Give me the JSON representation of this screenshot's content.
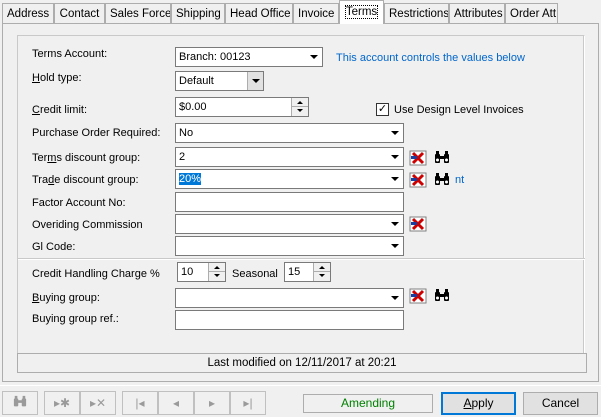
{
  "tabs": [
    "Address",
    "Contact",
    "Sales Force",
    "Shipping",
    "Head Office",
    "Invoice",
    "Terms",
    "Restrictions",
    "Attributes",
    "Order Att"
  ],
  "active_tab": "Terms",
  "form": {
    "terms_account": {
      "label": "Terms Account:",
      "value": "Branch: 00123"
    },
    "terms_account_note": "This account controls the values below",
    "hold_type": {
      "label_pre": "",
      "label_u": "H",
      "label_post": "old type:",
      "value": "Default"
    },
    "credit_limit": {
      "label_u": "C",
      "label_post": "redit limit:",
      "value": "$0.00"
    },
    "use_design_level_invoices": {
      "label": "Use Design Level Invoices",
      "checked_mark": "✓"
    },
    "purchase_order_required": {
      "label": "Purchase Order Required:",
      "value": "No"
    },
    "terms_discount_group": {
      "label_pre": "Ter",
      "label_u": "m",
      "label_post": "s discount group:",
      "value": "2"
    },
    "trade_discount_group": {
      "label_pre": "Tra",
      "label_u": "d",
      "label_post": "e discount group:",
      "value": "20%",
      "link_fragment": "nt"
    },
    "factor_account_no": {
      "label": "Factor Account No:",
      "value": ""
    },
    "overiding_commission": {
      "label": "Overiding Commission",
      "value": ""
    },
    "gl_code": {
      "label": "Gl Code:",
      "value": ""
    },
    "credit_handling_charge": {
      "label": "Credit Handling Charge %",
      "value": "10"
    },
    "seasonal": {
      "label": "Seasonal",
      "value": "15"
    },
    "buying_group": {
      "label_u": "B",
      "label_post": "uying group:",
      "value": ""
    },
    "buying_group_ref": {
      "label": "Buying group ref.:",
      "value": ""
    }
  },
  "status": "Last modified on 12/11/2017 at 20:21",
  "mode": "Amending",
  "buttons": {
    "apply": "Apply",
    "apply_u": "A",
    "apply_post": "pply",
    "cancel": "Cancel"
  },
  "icons": {
    "clear": "clear-red-x-icon",
    "find": "binoculars-icon"
  },
  "colors": {
    "accent": "#0078d7",
    "link": "#0066cc",
    "mode_text": "#008000",
    "clear_icon": "#cc0000"
  }
}
